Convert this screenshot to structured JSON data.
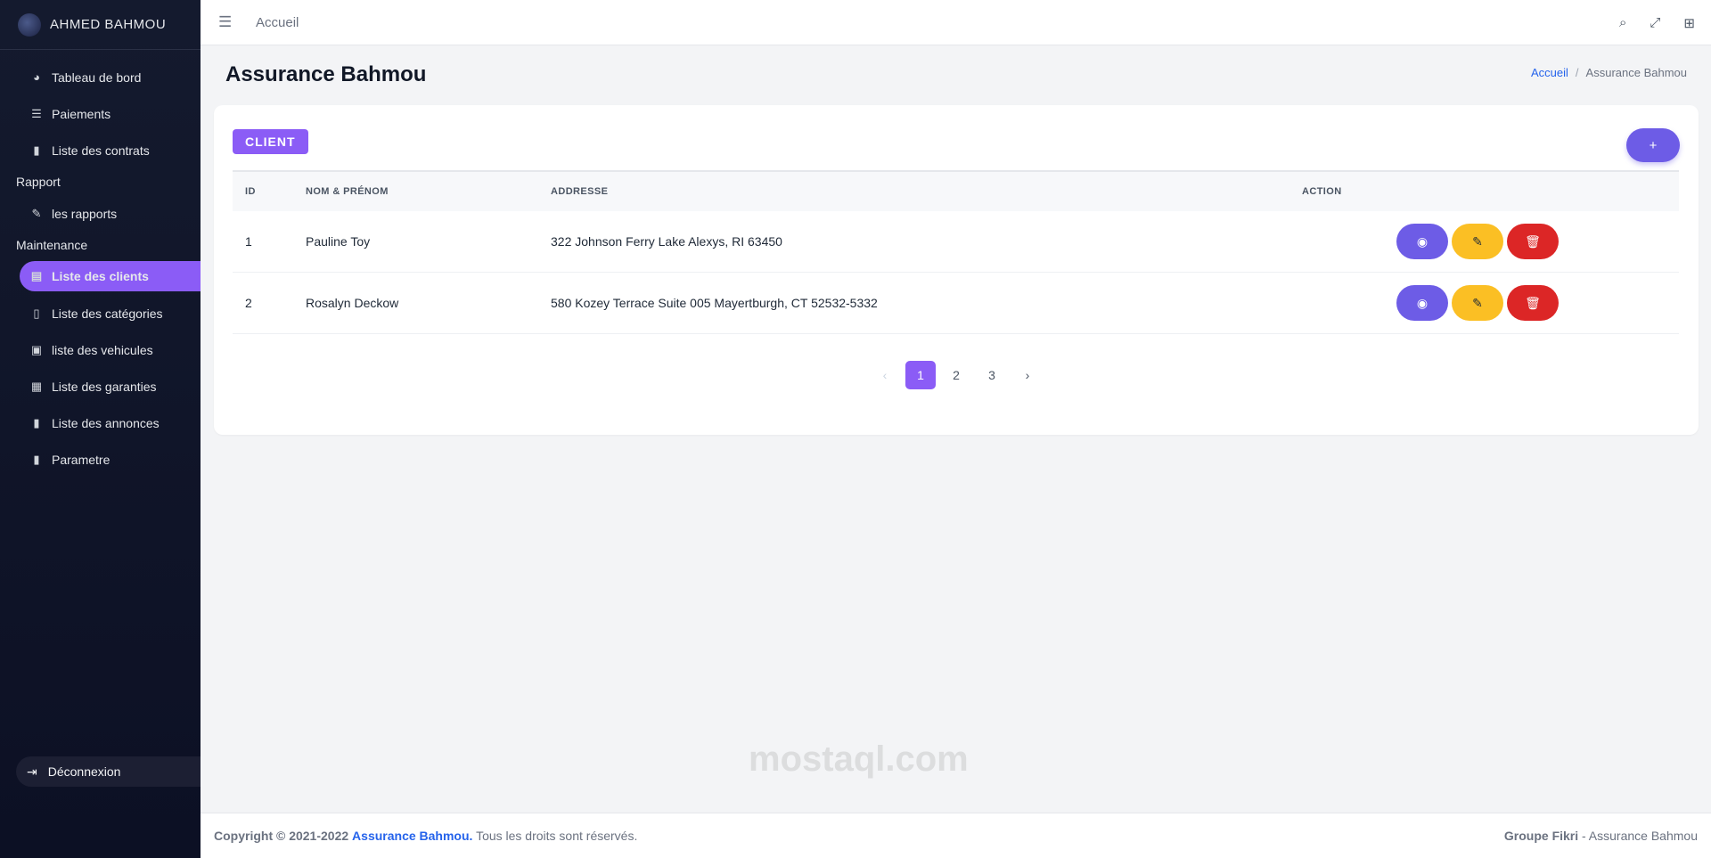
{
  "sidebar": {
    "brand": "AHMED BAHMOU",
    "items_top": [
      {
        "label": "Tableau de bord",
        "icon": "dashboard-icon",
        "glyph": "◕"
      },
      {
        "label": "Paiements",
        "icon": "list-icon",
        "glyph": "☰"
      },
      {
        "label": "Liste des contrats",
        "icon": "file-icon",
        "glyph": "▮"
      }
    ],
    "section_rapport": "Rapport",
    "items_rapport": [
      {
        "label": "les rapports",
        "icon": "file-edit-icon",
        "glyph": "✎"
      }
    ],
    "section_maintenance": "Maintenance",
    "items_maintenance": [
      {
        "label": "Liste des clients",
        "icon": "list-alt-icon",
        "glyph": "▤",
        "active": true
      },
      {
        "label": "Liste des catégories",
        "icon": "clipboard-icon",
        "glyph": "▯"
      },
      {
        "label": "liste des vehicules",
        "icon": "car-icon",
        "glyph": "▣"
      },
      {
        "label": "Liste des garanties",
        "icon": "calendar-icon",
        "glyph": "▦"
      },
      {
        "label": "Liste des annonces",
        "icon": "file-icon",
        "glyph": "▮"
      },
      {
        "label": "Parametre",
        "icon": "file-icon",
        "glyph": "▮"
      }
    ],
    "logout": "Déconnexion"
  },
  "topbar": {
    "home": "Accueil",
    "icons": [
      "search-icon",
      "expand-icon",
      "grid-icon"
    ]
  },
  "page": {
    "title": "Assurance Bahmou",
    "breadcrumb_home": "Accueil",
    "breadcrumb_current": "Assurance Bahmou"
  },
  "card": {
    "badge": "CLIENT",
    "add_label": "+",
    "headers": {
      "id": "ID",
      "name": "NOM & PRÉNOM",
      "address": "ADDRESSE",
      "action": "ACTION"
    },
    "rows": [
      {
        "id": "1",
        "name": "Pauline Toy",
        "address": "322 Johnson Ferry Lake Alexys, RI 63450"
      },
      {
        "id": "2",
        "name": "Rosalyn Deckow",
        "address": "580 Kozey Terrace Suite 005 Mayertburgh, CT 52532-5332"
      }
    ],
    "pagination": {
      "prev": "‹",
      "pages": [
        "1",
        "2",
        "3"
      ],
      "current": "1",
      "next": "›"
    }
  },
  "footer": {
    "copyright": "Copyright © 2021-2022",
    "brand": "Assurance Bahmou.",
    "rights": "Tous les droits sont réservés.",
    "right_strong": "Groupe Fikri",
    "right_rest": "- Assurance Bahmou"
  },
  "watermark": "mostaql.com"
}
